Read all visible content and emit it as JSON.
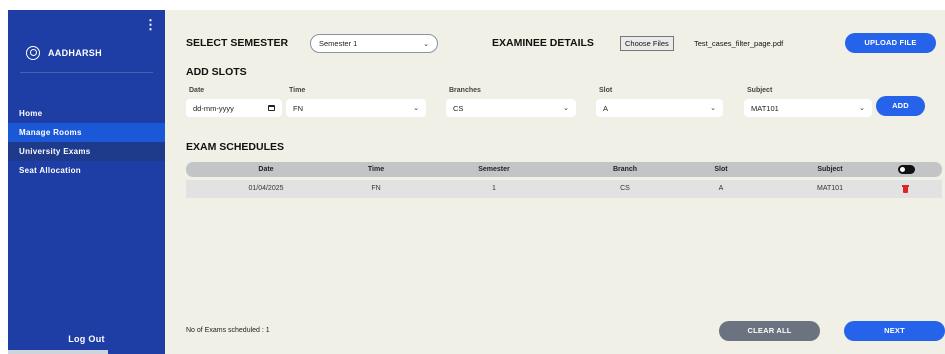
{
  "sidebar": {
    "user_name": "AADHARSH",
    "items": [
      {
        "label": "Home"
      },
      {
        "label": "Manage Rooms"
      },
      {
        "label": "University Exams"
      },
      {
        "label": "Seat Allocation"
      }
    ],
    "logout": "Log Out"
  },
  "header": {
    "select_semester_label": "SELECT SEMESTER",
    "semester_value": "Semester 1",
    "examinee_label": "EXAMINEE DETAILS",
    "choose_files": "Choose Files",
    "file_name": "Test_cases_filter_page.pdf",
    "upload": "UPLOAD FILE"
  },
  "add_slots": {
    "title": "ADD SLOTS",
    "date_label": "Date",
    "date_placeholder": "dd-mm-yyyy",
    "time_label": "Time",
    "time_value": "FN",
    "branches_label": "Branches",
    "branches_value": "CS",
    "slot_label": "Slot",
    "slot_value": "A",
    "subject_label": "Subject",
    "subject_value": "MAT101",
    "add": "ADD"
  },
  "schedules": {
    "title": "EXAM SCHEDULES",
    "columns": [
      "Date",
      "Time",
      "Semester",
      "Branch",
      "Slot",
      "Subject"
    ],
    "rows": [
      {
        "date": "01/04/2025",
        "time": "FN",
        "semester": "1",
        "branch": "CS",
        "slot": "A",
        "subject": "MAT101"
      }
    ]
  },
  "footer": {
    "count_text": "No of Exams scheduled : 1",
    "clear_all": "CLEAR ALL",
    "next": "NEXT"
  },
  "colors": {
    "sidebar_bg": "#1e3ea5",
    "active_item": "#1a58d8",
    "main_bg": "#f1f0e6",
    "primary_button": "#2563eb",
    "secondary_button": "#6b7280",
    "delete_icon": "#dc2626"
  },
  "icons": [
    "kebab-menu-icon",
    "user-circle-icon",
    "calendar-icon",
    "chevron-down-icon",
    "toggle-switch-icon",
    "trash-icon"
  ]
}
